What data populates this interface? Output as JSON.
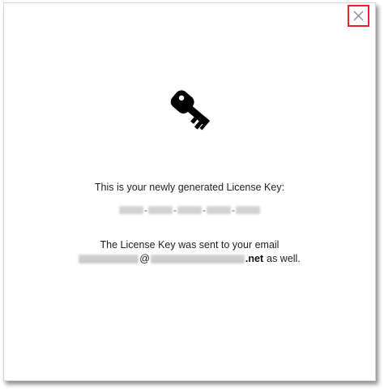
{
  "dialog": {
    "close_icon": "close-x-icon",
    "key_icon": "key-icon",
    "heading": "This is your newly generated License Key:",
    "license_key_separator": "-",
    "sent_text": "The License Key was sent to your email",
    "email_at": "@",
    "email_tld": ".net",
    "email_tail": "as well.",
    "colors": {
      "close_border": "#e0262b",
      "text": "#222222",
      "icon": "#000000"
    }
  }
}
